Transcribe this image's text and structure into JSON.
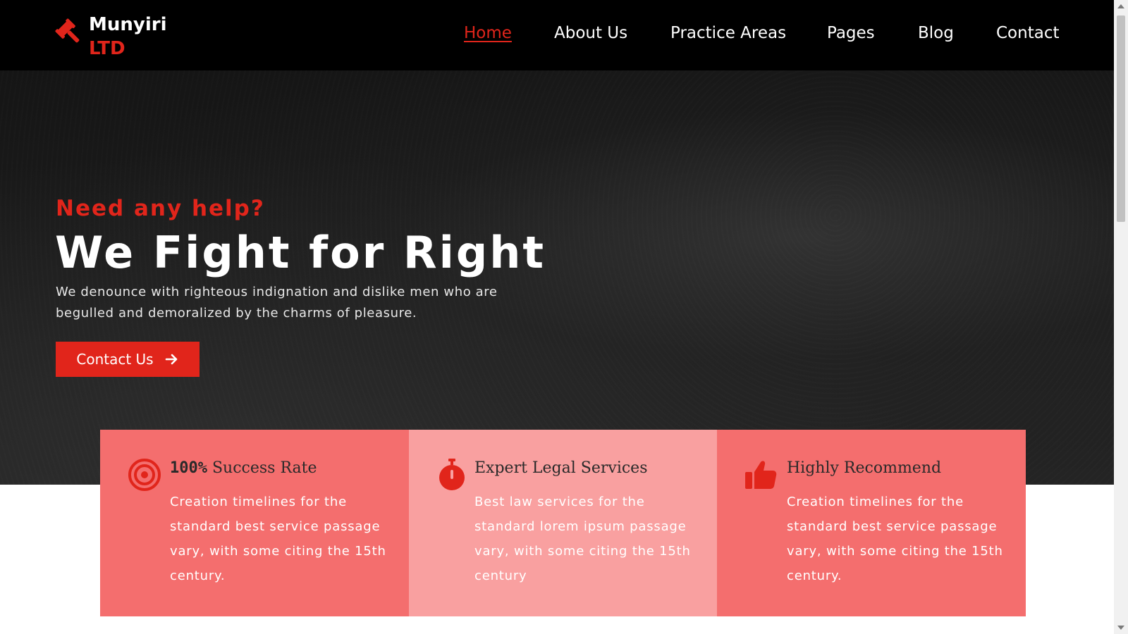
{
  "brand": {
    "name_line1": "Munyiri",
    "name_line2": "LTD",
    "icon": "gavel-icon"
  },
  "nav": {
    "items": [
      {
        "label": "Home",
        "active": true
      },
      {
        "label": "About Us"
      },
      {
        "label": "Practice Areas"
      },
      {
        "label": "Pages"
      },
      {
        "label": "Blog"
      },
      {
        "label": "Contact"
      }
    ]
  },
  "hero": {
    "eyebrow": "Need any help?",
    "title": "We Fight for Right",
    "description": "We denounce with righteous indignation and dislike men who are begulled and demoralized by the charms of pleasure.",
    "button_label": "Contact Us",
    "button_icon": "arrow-right-icon"
  },
  "features": [
    {
      "icon": "target-icon",
      "title_prefix": "100%",
      "title": " Success Rate",
      "description": "Creation timelines for the standard best service passage vary, with some citing the 15th century."
    },
    {
      "icon": "stopwatch-icon",
      "title_prefix": "",
      "title": "Expert Legal Services",
      "description": "Best law services for the standard lorem ipsum passage vary, with some citing the 15th century"
    },
    {
      "icon": "thumbs-up-icon",
      "title_prefix": "",
      "title": "Highly Recommend",
      "description": "Creation timelines for the standard best service passage vary, with some citing the 15th century."
    }
  ],
  "colors": {
    "accent": "#e1251b",
    "header_bg": "#000000",
    "card_primary": "#f46e6e",
    "card_light": "#f9a0a0"
  }
}
